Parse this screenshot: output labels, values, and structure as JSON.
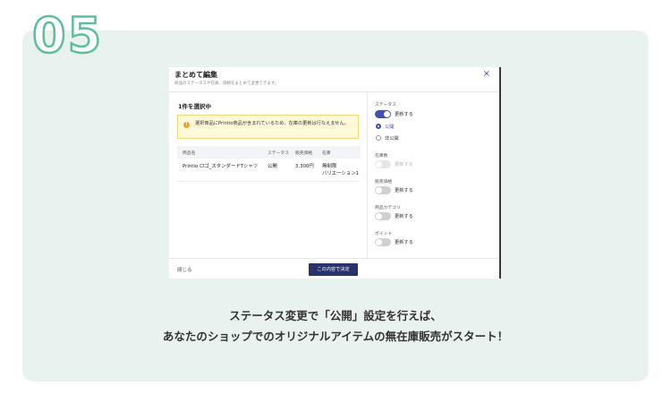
{
  "step_number": "05",
  "modal": {
    "title": "まとめて編集",
    "subtitle": "商品のステータスや在庫、価格をまとめて変更できます。",
    "close_icon": "×",
    "selected_count": "1件を選択中",
    "warning": {
      "icon": "!",
      "text": "選択商品にPrintio商品が含まれているため、在庫の更新は行なえません。"
    },
    "table": {
      "headers": [
        "商品名",
        "ステータス",
        "販売価格",
        "在庫"
      ],
      "rows": [
        {
          "name": "Printio ロゴ_スタンダードTシャツ",
          "status": "公開",
          "price": "3,300円",
          "stock_line1": "無制限",
          "stock_line2": "バリエーション1"
        }
      ]
    },
    "right_panel": {
      "status": {
        "label": "ステータス",
        "toggle_label": "更新する",
        "options": [
          "公開",
          "非公開"
        ]
      },
      "stock": {
        "label": "在庫数",
        "toggle_label": "更新する"
      },
      "price": {
        "label": "販売価格",
        "toggle_label": "更新する"
      },
      "category": {
        "label": "商品カテゴリ",
        "toggle_label": "更新する"
      },
      "point": {
        "label": "ポイント",
        "toggle_label": "更新する"
      }
    },
    "footer": {
      "cancel_label": "閉じる",
      "apply_label": "この内容で決定"
    }
  },
  "caption": {
    "line1": "ステータス変更で「公開」設定を行えば、",
    "line2": "あなたのショップでのオリジナルアイテムの無在庫販売がスタート！"
  },
  "colors": {
    "card_background": "#eaf2ef",
    "step_outline": "#5bbf98",
    "accent": "#3f4fb3",
    "apply_button": "#27326f",
    "warning_background": "#fff8d9"
  }
}
